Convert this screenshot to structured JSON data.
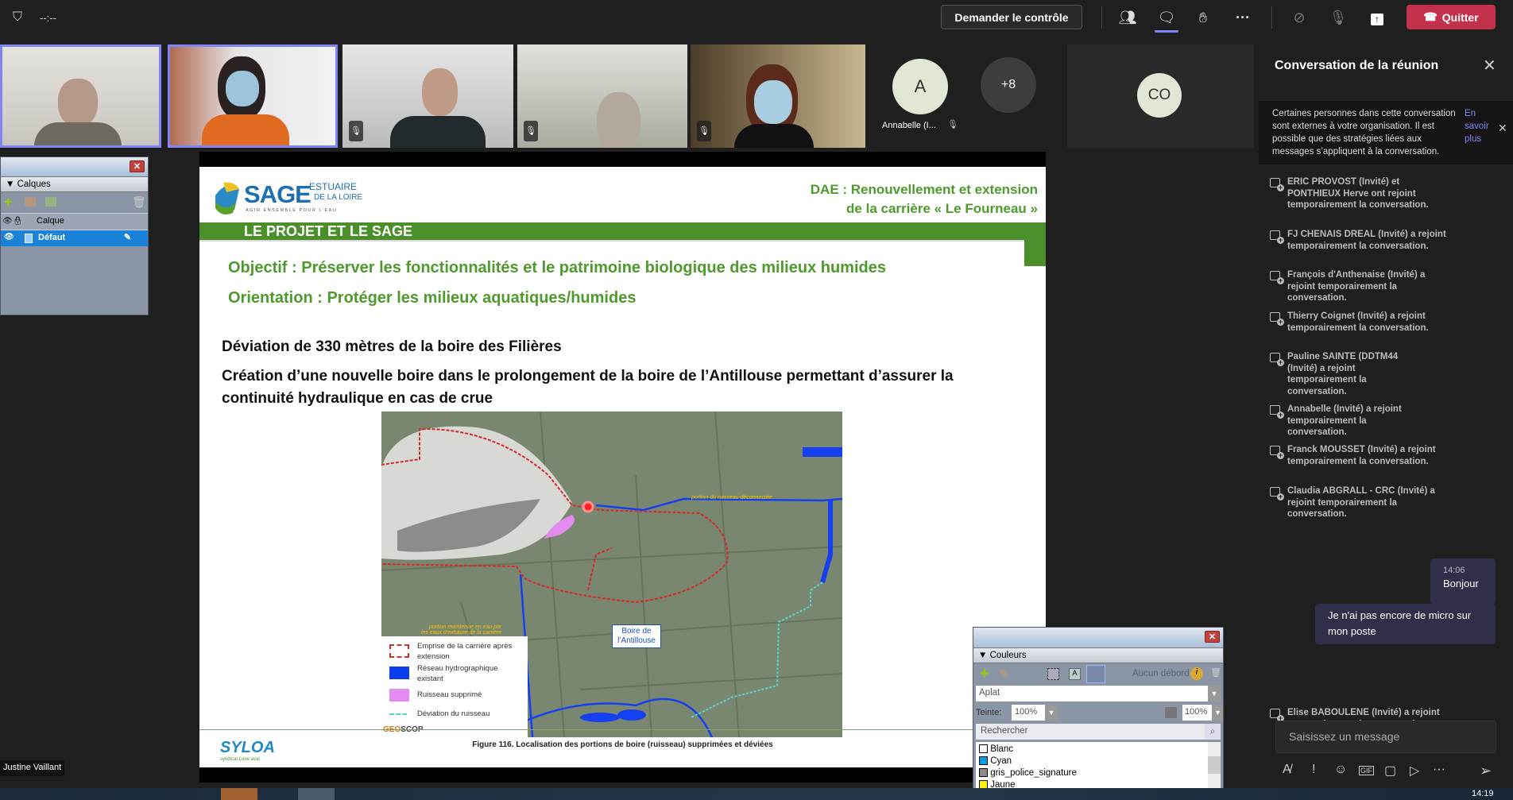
{
  "topbar": {
    "timer": "--:--",
    "request_control": "Demander le contrôle",
    "quit": "Quitter",
    "icons": [
      "shield-icon",
      "people-icon",
      "chat-icon",
      "reactions-icon",
      "more-icon",
      "camera-off-icon",
      "mic-off-icon",
      "share-icon",
      "hangup-icon"
    ]
  },
  "participants": {
    "annabelle_initial": "A",
    "annabelle_name": "Annabelle (I...",
    "overflow": "+8",
    "co_initial": "CO"
  },
  "presenter_label": "Justine Vaillant",
  "slide": {
    "logo_main": "SAGE",
    "logo_sub1": "ESTUAIRE",
    "logo_sub2": "DE LA LOIRE",
    "logo_tag": "AGIR ENSEMBLE POUR L'EAU",
    "header_line1": "DAE : Renouvellement et extension",
    "header_line2": "de la carrière « Le Fourneau »",
    "band_title": "LE PROJET ET LE SAGE",
    "objective": "Objectif : Préserver les fonctionnalités et le patrimoine biologique des milieux humides",
    "orientation": "Orientation : Protéger les milieux aquatiques/humides",
    "point1": "Déviation de 330 mètres de la boire des Filières",
    "point2": "Création d’une nouvelle boire dans le prolongement de la boire de l’Antillouse permettant d’assurer la continuité hydraulique en cas de crue",
    "map": {
      "label_disconnected": "portion du ruisseau déconnectée",
      "label_maintained_1": "portion maintenue en eau par",
      "label_maintained_2": "les eaux d'exhaure de la carrière",
      "callout": "Boire de l’Antillouse",
      "legend": [
        {
          "label": "Emprise de la carrière après extension",
          "color": "#c0392b"
        },
        {
          "label": "Réseau hydrographique existant",
          "color": "#0a3cf0"
        },
        {
          "label": "Ruisseau supprimé",
          "color": "#e58af0"
        },
        {
          "label": "Déviation du ruisseau",
          "color": "#55d6d6"
        }
      ],
      "geoscop_1": "GEO",
      "geoscop_2": "SCOP"
    },
    "caption": "Figure 116. Localisation des portions de boire (ruisseau) supprimées et déviées",
    "footer_logo": "SYLOA",
    "footer_logo_sub": "syndicat Loire aval"
  },
  "calques_panel": {
    "title": "Calques",
    "column": "Calque",
    "layer": "Défaut"
  },
  "couleurs_panel": {
    "title": "Couleurs",
    "overprint": "Aucun débord",
    "type": "Aplat",
    "tint_label": "Teinte:",
    "tint": "100%",
    "opacity": "100%",
    "search_placeholder": "Rechercher",
    "swatches": [
      {
        "name": "Blanc",
        "color": "#ffffff"
      },
      {
        "name": "Cyan",
        "color": "#00a0e3"
      },
      {
        "name": "gris_police_signature",
        "color": "#8c8c8c"
      },
      {
        "name": "Jaune",
        "color": "#fff200"
      }
    ]
  },
  "chat": {
    "title": "Conversation de la réunion",
    "banner": "Certaines personnes dans cette conversation sont externes à votre organisation. Il est possible que des stratégies liées aux messages s’appliquent à la conversation.",
    "banner_link": "En savoir plus",
    "events": [
      "ERIC PROVOST (Invité) et PONTHIEUX Herve ont rejoint temporairement la conversation.",
      "FJ CHENAIS DREAL (Invité) a rejoint temporairement la conversation.",
      "François d'Anthenaise (Invité) a rejoint temporairement la conversation.",
      "Thierry Coignet (Invité) a rejoint temporairement la conversation.",
      "Pauline SAINTE (DDTM44 (Invité) a rejoint temporairement la conversation.",
      "Annabelle (Invité) a rejoint temporairement la conversation.",
      "Franck MOUSSET (Invité) a rejoint temporairement la conversation.",
      "Claudia ABGRALL - CRC (Invité) a rejoint temporairement la conversation."
    ],
    "messages": [
      {
        "time": "14:06",
        "text": "Bonjour"
      },
      {
        "text": "Je n'ai pas encore de micro sur mon poste"
      }
    ],
    "last_event": "Elise BABOULENE (Invité) a rejoint temporairement la conversation.",
    "input_placeholder": "Saisissez un message"
  },
  "taskbar": {
    "time": "14:19"
  }
}
